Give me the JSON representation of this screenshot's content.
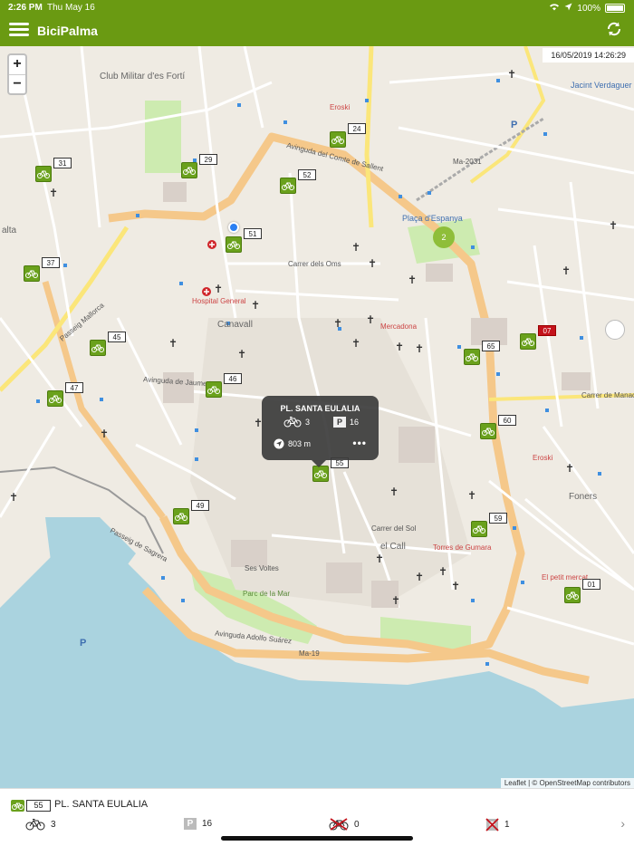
{
  "status_bar": {
    "time": "2:26 PM",
    "date": "Thu May 16",
    "battery": "100%"
  },
  "app": {
    "title": "BiciPalma"
  },
  "map": {
    "timestamp": "16/05/2019 14:26:29",
    "zoom_in": "+",
    "zoom_out": "−",
    "attribution": "Leaflet | © OpenStreetMap contributors",
    "labels": {
      "club_militar": "Club Militar d'es Fortí",
      "canavall": "Canavall",
      "hospital": "Hospital General",
      "placa_espanya": "Plaça d'Espanya",
      "jacint": "Jacint Verdaguer",
      "mercadona": "Mercadona",
      "foners": "Foners",
      "el_call": "el Call",
      "ses_voltes": "Ses Voltes",
      "parc_mar": "Parc de la Mar",
      "torres": "Torres de Gumara",
      "petit_mercat": "El petit mercat",
      "eroski_top": "Eroski",
      "eroski_right": "Eroski",
      "ma2031": "Ma-2031",
      "ma19": "Ma-19",
      "av_adolfo": "Avinguda Adolfo Suárez",
      "av_comte": "Avinguda del Comte de Sallent",
      "passeig_mallorca": "Passeig Mallorca",
      "carrer_manacor": "Carrer de Manacor",
      "carrer_oms": "Carrer dels Oms",
      "carrer_sol": "Carrer del Sol",
      "av_jaume": "Avinguda de Jaume III",
      "passeig_sagrera": "Passeig de Sagrera",
      "alta": "alta"
    },
    "stations": [
      {
        "id": "31",
        "label": "31"
      },
      {
        "id": "29",
        "label": "29"
      },
      {
        "id": "24",
        "label": "24"
      },
      {
        "id": "52",
        "label": "52"
      },
      {
        "id": "51",
        "label": "51"
      },
      {
        "id": "37",
        "label": "37"
      },
      {
        "id": "45",
        "label": "45"
      },
      {
        "id": "46",
        "label": "46"
      },
      {
        "id": "47",
        "label": "47"
      },
      {
        "id": "49",
        "label": "49"
      },
      {
        "id": "55",
        "label": "55"
      },
      {
        "id": "59",
        "label": "59"
      },
      {
        "id": "60",
        "label": "60"
      },
      {
        "id": "65",
        "label": "65"
      },
      {
        "id": "07",
        "label": "07"
      },
      {
        "id": "01",
        "label": "01"
      }
    ],
    "cluster": {
      "count": "2"
    }
  },
  "popup": {
    "title": "PL. SANTA EULALIA",
    "bikes": "3",
    "parking": "16",
    "parking_icon": "P",
    "distance": "803 m",
    "more": "•••"
  },
  "bottom": {
    "station_number": "55",
    "station_name": "PL. SANTA EULALIA",
    "bikes": "3",
    "parking_icon": "P",
    "parking": "16",
    "broken_bikes": "0",
    "broken_docks": "1",
    "chevron": "›"
  },
  "colors": {
    "brand": "#6a9a12",
    "station": "#6aa11c",
    "alert": "#c4121b",
    "road_major": "#f5c88a"
  }
}
